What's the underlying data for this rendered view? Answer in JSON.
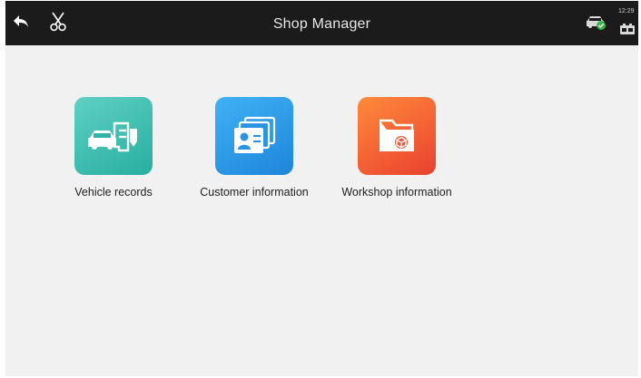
{
  "header": {
    "title": "Shop Manager",
    "status_time": "12:29"
  },
  "icons": {
    "back": "back-arrow-icon",
    "screenshot": "scissors-icon",
    "vci": "car-connection-icon",
    "battery": "battery-icon"
  },
  "apps": [
    {
      "label": "Vehicle records",
      "icon": "vehicle-records-icon",
      "color": "#3cc0b2"
    },
    {
      "label": "Customer information",
      "icon": "customer-card-icon",
      "color": "#2f9de8"
    },
    {
      "label": "Workshop information",
      "icon": "workshop-folder-icon",
      "color": "#f2603a"
    }
  ]
}
